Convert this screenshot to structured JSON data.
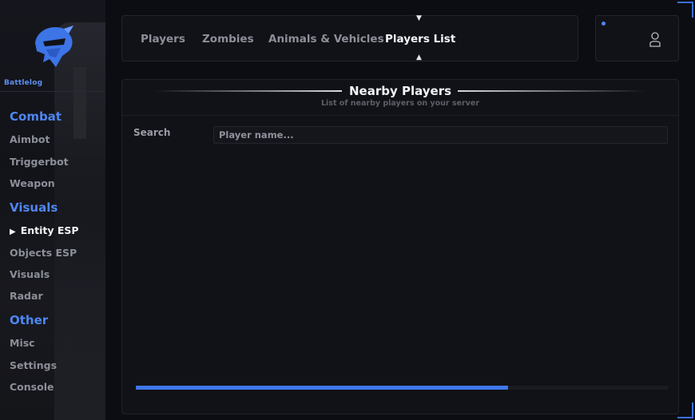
{
  "brand": {
    "name": "Battlelog",
    "accent": "#4f86f0"
  },
  "sidebar": {
    "sections": [
      {
        "title": "Combat",
        "items": [
          "Aimbot",
          "Triggerbot",
          "Weapon"
        ]
      },
      {
        "title": "Visuals",
        "items": [
          "Entity ESP",
          "Objects ESP",
          "Visuals",
          "Radar"
        ]
      },
      {
        "title": "Other",
        "items": [
          "Misc",
          "Settings",
          "Console"
        ]
      }
    ],
    "active_item": "Entity ESP",
    "active_marker": "▶"
  },
  "tabs": {
    "items": [
      "Players",
      "Zombies",
      "Animals & Vehicles",
      "Players List"
    ],
    "active": "Players List",
    "marker_top": "▼",
    "marker_bottom": "▲"
  },
  "user": {
    "icon": "user-icon",
    "status_color": "#4f86f0"
  },
  "panel": {
    "title": "Nearby Players",
    "subtitle": "List of nearby players on your server",
    "search_label": "Search",
    "search_placeholder": "Player name...",
    "search_value": "",
    "progress": 0.7
  }
}
